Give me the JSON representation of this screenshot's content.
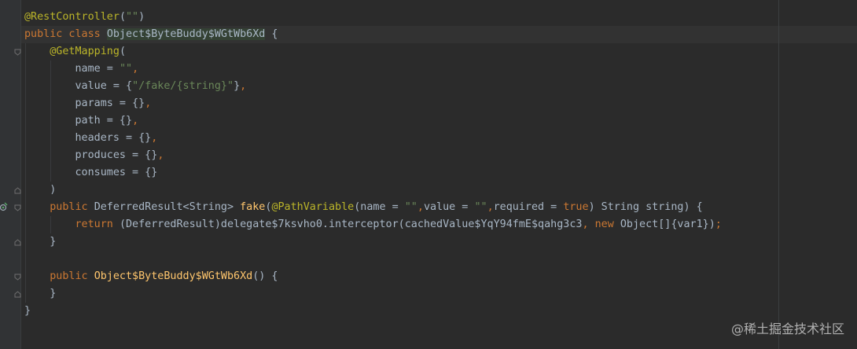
{
  "editor": {
    "lines": [
      [
        {
          "c": "anno",
          "t": "@RestController"
        },
        {
          "c": "plain",
          "t": "("
        },
        {
          "c": "str",
          "t": "\"\""
        },
        {
          "c": "plain",
          "t": ")"
        }
      ],
      [
        {
          "c": "kw",
          "t": "public class "
        },
        {
          "c": "cls-hl",
          "t": "Object$ByteBuddy$WGtWb6Xd"
        },
        {
          "c": "plain",
          "t": " {"
        }
      ],
      [
        {
          "c": "plain",
          "t": "    "
        },
        {
          "c": "anno",
          "t": "@GetMapping"
        },
        {
          "c": "plain",
          "t": "("
        }
      ],
      [
        {
          "c": "plain",
          "t": "        name = "
        },
        {
          "c": "str",
          "t": "\"\""
        },
        {
          "c": "kw",
          "t": ","
        }
      ],
      [
        {
          "c": "plain",
          "t": "        value = {"
        },
        {
          "c": "str",
          "t": "\"/fake/{string}\""
        },
        {
          "c": "plain",
          "t": "}"
        },
        {
          "c": "kw",
          "t": ","
        }
      ],
      [
        {
          "c": "plain",
          "t": "        params = {}"
        },
        {
          "c": "kw",
          "t": ","
        }
      ],
      [
        {
          "c": "plain",
          "t": "        path = {}"
        },
        {
          "c": "kw",
          "t": ","
        }
      ],
      [
        {
          "c": "plain",
          "t": "        headers = {}"
        },
        {
          "c": "kw",
          "t": ","
        }
      ],
      [
        {
          "c": "plain",
          "t": "        produces = {}"
        },
        {
          "c": "kw",
          "t": ","
        }
      ],
      [
        {
          "c": "plain",
          "t": "        consumes = {}"
        }
      ],
      [
        {
          "c": "plain",
          "t": "    )"
        }
      ],
      [
        {
          "c": "plain",
          "t": "    "
        },
        {
          "c": "kw",
          "t": "public "
        },
        {
          "c": "plain",
          "t": "DeferredResult<String> "
        },
        {
          "c": "fn",
          "t": "fake"
        },
        {
          "c": "plain",
          "t": "("
        },
        {
          "c": "anno",
          "t": "@PathVariable"
        },
        {
          "c": "plain",
          "t": "(name = "
        },
        {
          "c": "str",
          "t": "\"\""
        },
        {
          "c": "kw",
          "t": ","
        },
        {
          "c": "plain",
          "t": "value = "
        },
        {
          "c": "str",
          "t": "\"\""
        },
        {
          "c": "kw",
          "t": ","
        },
        {
          "c": "plain",
          "t": "required = "
        },
        {
          "c": "kw",
          "t": "true"
        },
        {
          "c": "plain",
          "t": ") String string) {"
        }
      ],
      [
        {
          "c": "plain",
          "t": "        "
        },
        {
          "c": "kw",
          "t": "return "
        },
        {
          "c": "plain",
          "t": "(DeferredResult)delegate$7ksvho0.interceptor(cachedValue$YqY94fmE$qahg3c3"
        },
        {
          "c": "kw",
          "t": ", new "
        },
        {
          "c": "plain",
          "t": "Object[]{var1})"
        },
        {
          "c": "kw",
          "t": ";"
        }
      ],
      [
        {
          "c": "plain",
          "t": "    }"
        }
      ],
      [
        {
          "c": "plain",
          "t": ""
        }
      ],
      [
        {
          "c": "plain",
          "t": "    "
        },
        {
          "c": "kw",
          "t": "public "
        },
        {
          "c": "fn",
          "t": "Object$ByteBuddy$WGtWb6Xd"
        },
        {
          "c": "plain",
          "t": "() {"
        }
      ],
      [
        {
          "c": "plain",
          "t": "    }"
        }
      ],
      [
        {
          "c": "plain",
          "t": "}"
        }
      ]
    ]
  },
  "watermark": {
    "text": "@稀土掘金技术社区"
  },
  "icons": [
    "fold-marker-icon",
    "run-gutter-icon"
  ],
  "colors": {
    "background": "#2b2b2b",
    "annotation": "#bbb529",
    "keyword": "#cc7832",
    "string": "#6a8759",
    "method": "#ffc66d",
    "text": "#a9b7c6"
  }
}
